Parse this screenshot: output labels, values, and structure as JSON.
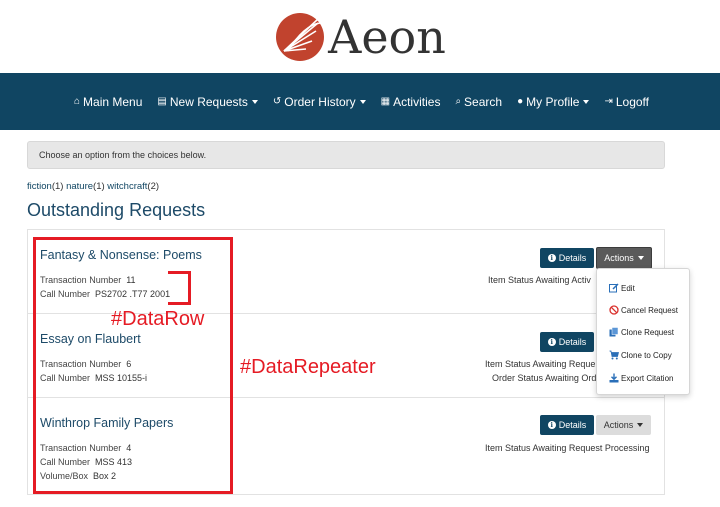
{
  "logo": {
    "text": "Aeon",
    "mark_color": "#c1432e"
  },
  "nav": [
    {
      "icon": "home-icon",
      "glyph": "⌂",
      "label": "Main Menu",
      "caret": false
    },
    {
      "icon": "book-icon",
      "glyph": "▤",
      "label": "New Requests",
      "caret": true
    },
    {
      "icon": "history-icon",
      "glyph": "↺",
      "label": "Order History",
      "caret": true
    },
    {
      "icon": "calendar-icon",
      "glyph": "▦",
      "label": "Activities",
      "caret": false
    },
    {
      "icon": "search-icon",
      "glyph": "⌕",
      "label": "Search",
      "caret": false
    },
    {
      "icon": "user-icon",
      "glyph": "●",
      "label": "My Profile",
      "caret": true
    },
    {
      "icon": "logoff-icon",
      "glyph": "⇥",
      "label": "Logoff",
      "caret": false
    }
  ],
  "alert": {
    "text": "Choose an option from the choices below."
  },
  "tags": [
    {
      "name": "fiction",
      "count": "(1)"
    },
    {
      "name": "nature",
      "count": "(1)"
    },
    {
      "name": "witchcraft",
      "count": "(2)"
    }
  ],
  "heading": "Outstanding Requests",
  "buttons": {
    "details": "Details",
    "actions": "Actions"
  },
  "requests": [
    {
      "title": "Fantasy & Nonsense: Poems",
      "fields": [
        {
          "label": "Transaction Number",
          "value": "11"
        },
        {
          "label": "Call Number",
          "value": "PS2702 .T77 2001"
        }
      ],
      "status": [
        {
          "label": "Item Status",
          "value": "Awaiting Activ"
        }
      ]
    },
    {
      "title": "Essay on Flaubert",
      "fields": [
        {
          "label": "Transaction Number",
          "value": "6"
        },
        {
          "label": "Call Number",
          "value": "MSS 10155-i"
        }
      ],
      "status": [
        {
          "label": "Item Status",
          "value": "Awaiting Reque"
        },
        {
          "label": "Order Status",
          "value": "Awaiting Ord"
        }
      ]
    },
    {
      "title": "Winthrop Family Papers",
      "fields": [
        {
          "label": "Transaction Number",
          "value": "4"
        },
        {
          "label": "Call Number",
          "value": "MSS 413"
        },
        {
          "label": "Volume/Box",
          "value": "Box 2"
        }
      ],
      "status": [
        {
          "label": "Item Status",
          "value": "Awaiting Request Processing"
        }
      ]
    }
  ],
  "actions_menu": [
    {
      "icon": "edit-icon",
      "label": "Edit"
    },
    {
      "icon": "cancel-icon",
      "label": "Cancel Request"
    },
    {
      "icon": "clone-icon",
      "label": "Clone Request"
    },
    {
      "icon": "cart-icon",
      "label": "Clone to Copy"
    },
    {
      "icon": "export-icon",
      "label": "Export Citation"
    }
  ],
  "annotations": {
    "row": "#DataRow",
    "repeater": "#DataRepeater",
    "color": "#e51b24"
  }
}
